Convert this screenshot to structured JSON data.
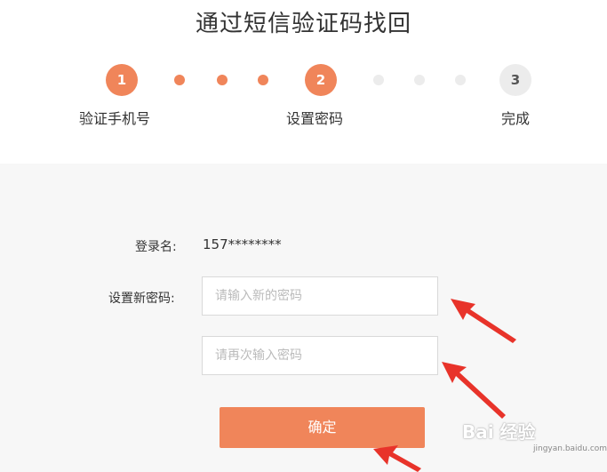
{
  "page_title": "通过短信验证码找回",
  "steps": [
    {
      "number": "1",
      "label": "验证手机号"
    },
    {
      "number": "2",
      "label": "设置密码"
    },
    {
      "number": "3",
      "label": "完成"
    }
  ],
  "form": {
    "login_label": "登录名:",
    "login_value": "157********",
    "new_password_label": "设置新密码:",
    "new_password_placeholder": "请输入新的密码",
    "confirm_password_placeholder": "请再次输入密码",
    "submit_label": "确定"
  },
  "colors": {
    "accent": "#f0855a",
    "arrow": "#e8332a",
    "inactive": "#ececec",
    "panel_bg": "#f7f7f7"
  },
  "watermark": {
    "text": "Bai 经验",
    "sub": "jingyan.baidu.com"
  }
}
